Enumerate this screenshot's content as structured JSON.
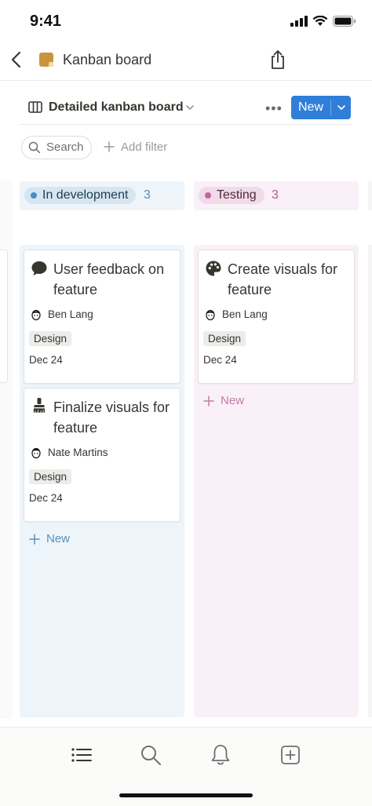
{
  "status_bar": {
    "time": "9:41"
  },
  "header": {
    "title": "Kanban board",
    "back_icon": "chevron-left-icon",
    "share_icon": "share-icon"
  },
  "toolbar": {
    "view_name": "Detailed kanban board",
    "view_icon": "board-view-icon",
    "more_label": "•••",
    "new_label": "New"
  },
  "filters": {
    "search_label": "Search",
    "add_filter_label": "Add filter"
  },
  "columns": [
    {
      "name": "In development",
      "count": "3",
      "color": "#5c8fb5",
      "cards": [
        {
          "icon": "speech-bubble-icon",
          "title": "User feedback on feature",
          "assignee": "Ben Lang",
          "tag": "Design",
          "date": "Dec 24"
        },
        {
          "icon": "paintbrush-icon",
          "title": "Finalize visuals for feature",
          "assignee": "Nate Martins",
          "tag": "Design",
          "date": "Dec 24"
        }
      ],
      "add_label": "New"
    },
    {
      "name": "Testing",
      "count": "3",
      "color": "#c2669e",
      "cards": [
        {
          "icon": "palette-icon",
          "title": "Create visuals for feature",
          "assignee": "Ben Lang",
          "tag": "Design",
          "date": "Dec 24"
        }
      ],
      "add_label": "New"
    }
  ],
  "tab_bar": [
    "list-icon",
    "search-icon",
    "bell-icon",
    "new-page-icon"
  ],
  "colors": {
    "accent": "#2f7ed8",
    "dev_bg": "#eef5fa",
    "test_bg": "#f9f1f7"
  }
}
